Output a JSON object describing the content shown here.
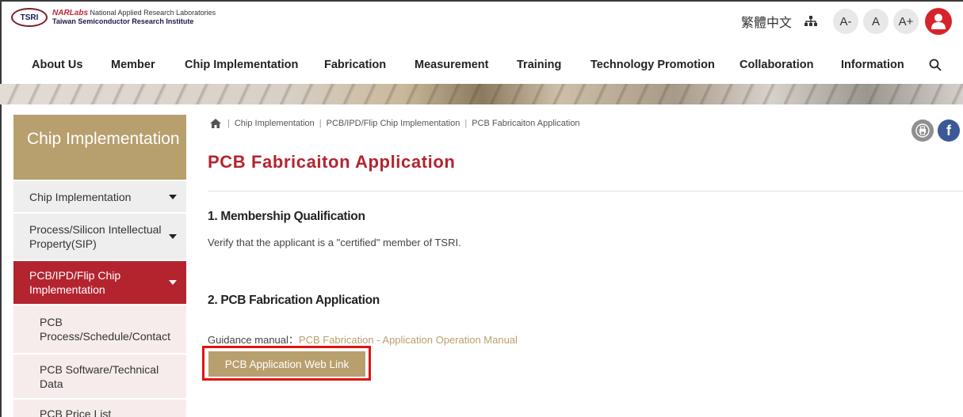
{
  "header": {
    "logo_badge": "TSRI",
    "logo_brand": "NARLabs",
    "logo_line1": "National Applied Research Laboratories",
    "logo_line2": "Taiwan Semiconductor Research Institute",
    "language": "繁體中文",
    "font_small": "A-",
    "font_normal": "A",
    "font_large": "A+",
    "sitemap_icon": "sitemap-icon",
    "user_icon": "user-icon"
  },
  "nav": {
    "items": [
      "About Us",
      "Member",
      "Chip Implementation",
      "Fabrication",
      "Measurement",
      "Training",
      "Technology Promotion",
      "Collaboration",
      "Information"
    ],
    "search_icon": "search-icon"
  },
  "sidebar": {
    "title": "Chip Implementation",
    "items": [
      {
        "label": "Chip Implementation"
      },
      {
        "label": "Process/Silicon Intellectual Property(SIP)"
      },
      {
        "label": "PCB/IPD/Flip Chip Implementation"
      }
    ],
    "subitems": [
      {
        "label": "PCB Process/Schedule/Contact"
      },
      {
        "label": "PCB Software/Technical Data"
      },
      {
        "label": "PCB Price List"
      }
    ]
  },
  "breadcrumb": {
    "home_icon": "home-icon",
    "items": [
      "Chip Implementation",
      "PCB/IPD/Flip Chip Implementation",
      "PCB Fabricaiton Application"
    ]
  },
  "share": {
    "print_icon": "print-icon",
    "facebook_icon": "facebook-icon",
    "facebook_glyph": "f"
  },
  "main": {
    "title": "PCB Fabricaiton Application",
    "section1_heading": "1. Membership Qualification",
    "section1_text": "Verify that the applicant is a \"certified\" member of TSRI.",
    "section2_heading": "2. PCB Fabrication Application",
    "guidance_label": "Guidance manual：",
    "guidance_link": "PCB Fabrication - Application Operation Manual",
    "button_label": "PCB Application Web Link"
  },
  "colors": {
    "accent_gold": "#b89f6e",
    "accent_red": "#b3242f",
    "highlight_red": "#e01414"
  }
}
